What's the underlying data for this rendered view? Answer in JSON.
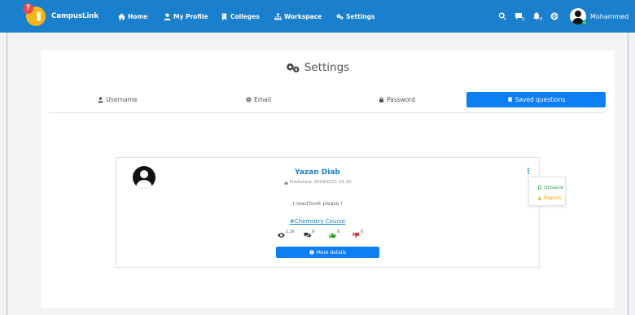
{
  "navbar": {
    "brand": "CampusLink",
    "links": [
      "Home",
      "My Profile",
      "Colleges",
      "Workspace",
      "Settings"
    ],
    "notification_counts": [
      "0",
      "0"
    ],
    "user_name": "Mohammed"
  },
  "settings": {
    "title": "Settings",
    "tabs": [
      "Username",
      "Email",
      "Password",
      "Saved questions"
    ],
    "active_tab": "Saved questions"
  },
  "post": {
    "author": "Yazan Diab",
    "published": "Published: 2024/0/23 18:10",
    "question": "I need book please !",
    "hashtag": "#Chemistry Course",
    "views": "1.2k",
    "comments": "9",
    "likes": "0",
    "dislikes": "0",
    "details_label": "More details"
  },
  "dropdown": {
    "unsave": "Unsave",
    "report": "Report"
  },
  "colors": {
    "navbar": "#1a7fcc",
    "active_tab": "#0d7ff5",
    "like": "#22a322",
    "dislike": "#e23434",
    "unsave": "#2ea44f",
    "report": "#e3a600"
  }
}
